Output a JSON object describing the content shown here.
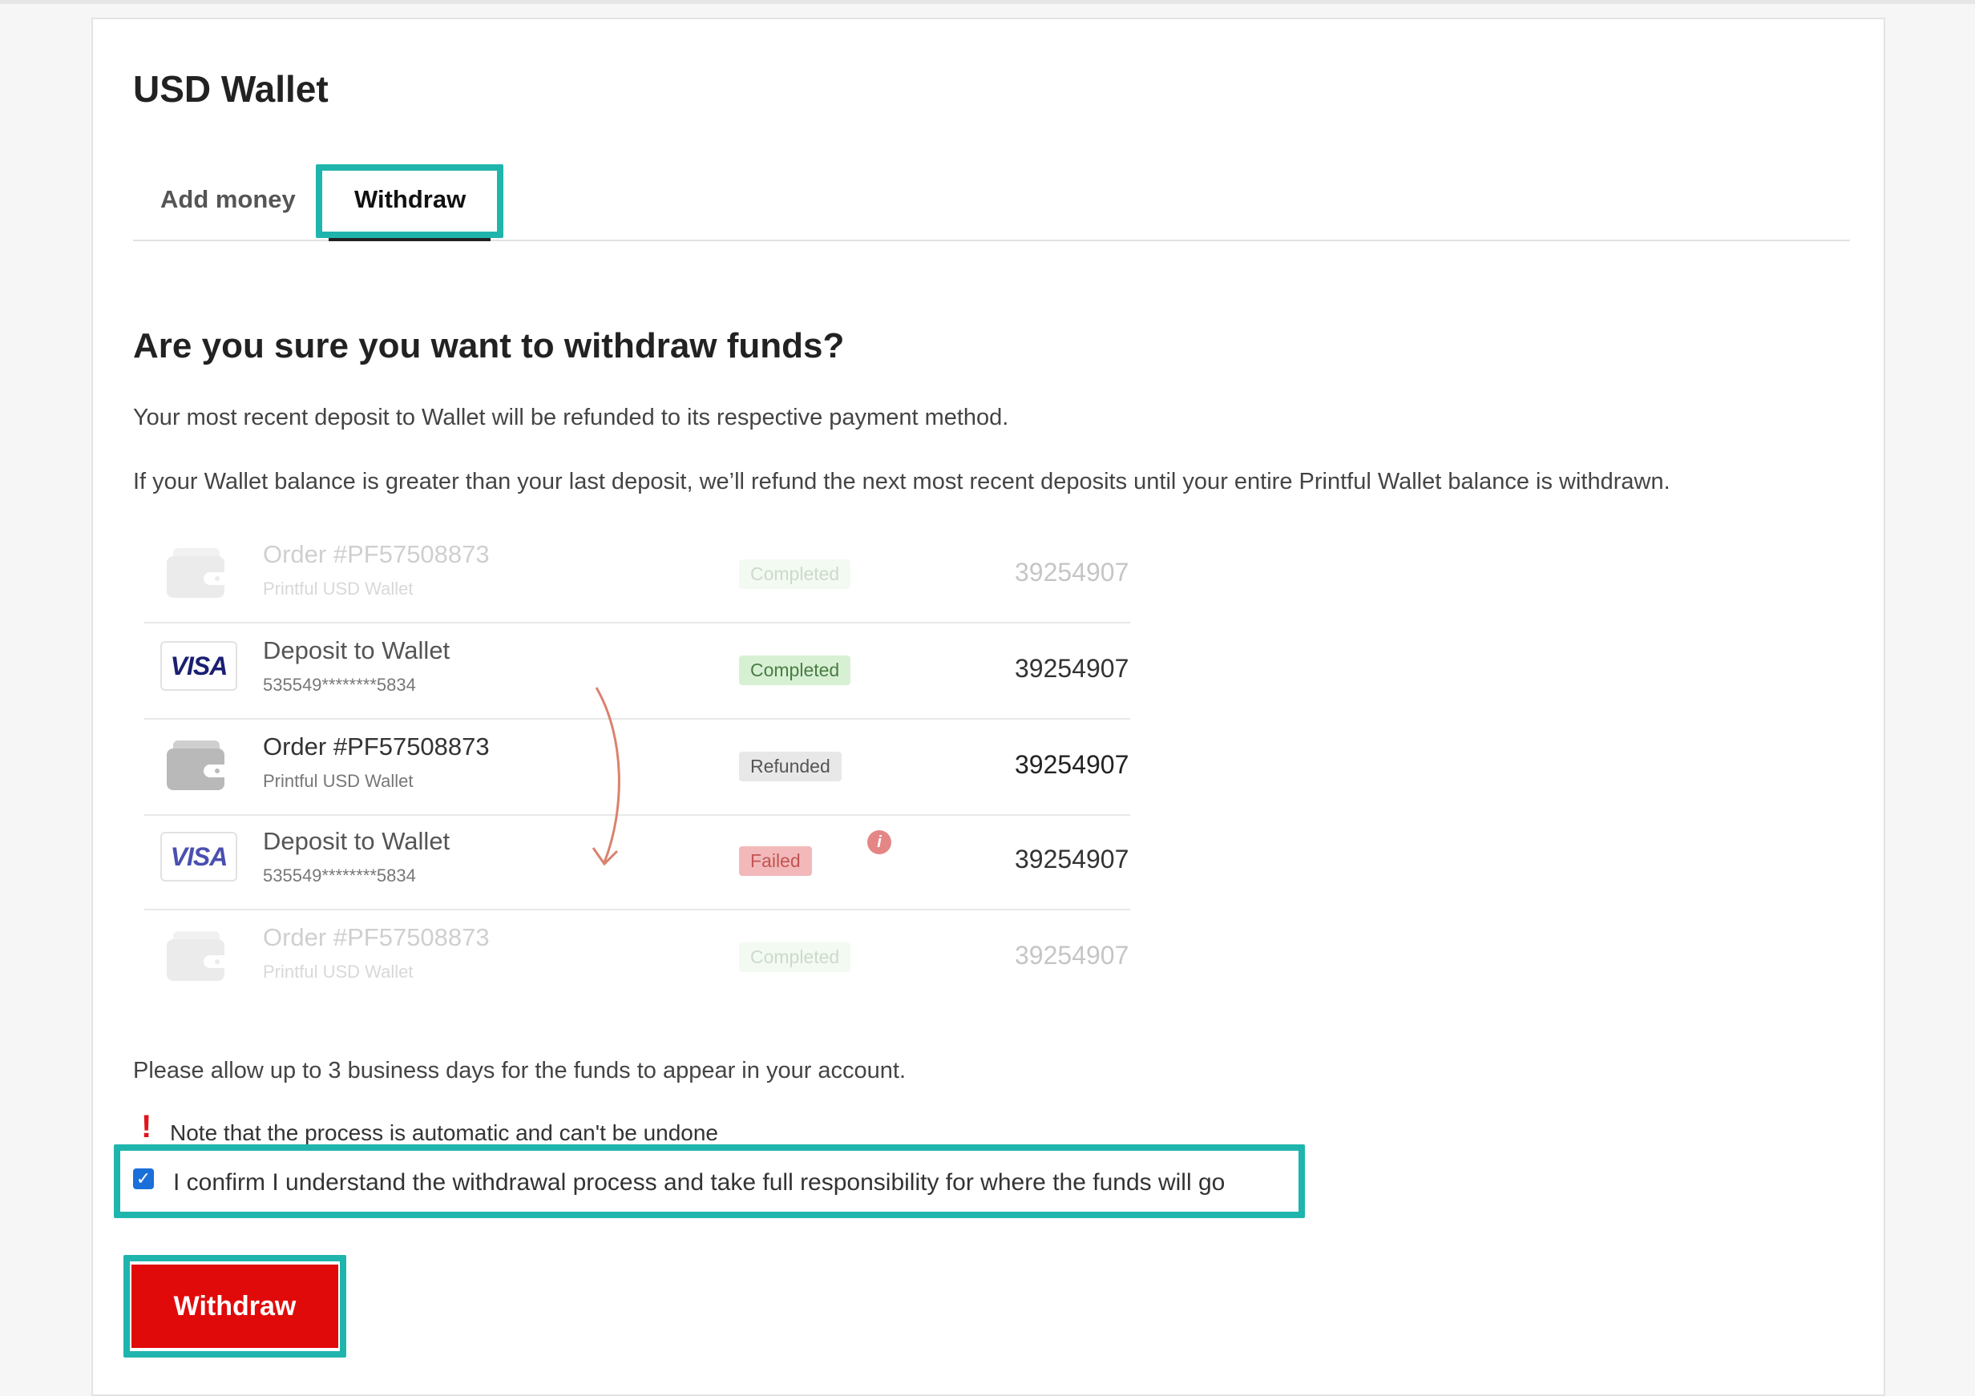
{
  "wallet_title": "USD Wallet",
  "tabs": [
    {
      "label": "Add money",
      "active": false
    },
    {
      "label": "Withdraw",
      "active": true
    }
  ],
  "heading": "Are you sure you want to withdraw funds?",
  "paragraphs": [
    "Your most recent deposit to Wallet will be refunded to its respective payment method.",
    "If your Wallet balance is greater than your last deposit, we’ll refund the next most recent deposits until your entire Printful Wallet balance is withdrawn."
  ],
  "transactions": [
    {
      "icon": "wallet-icon",
      "name": "Order #PF57508873",
      "sub": "Printful USD Wallet",
      "status": "Completed",
      "amount": "39254907",
      "faded": true
    },
    {
      "icon": "visa-icon",
      "name": "Deposit to Wallet",
      "sub": "535549********5834",
      "status": "Completed",
      "amount": "39254907",
      "faded": false
    },
    {
      "icon": "wallet-icon",
      "name": "Order #PF57508873",
      "sub": "Printful USD Wallet",
      "status": "Refunded",
      "amount": "39254907",
      "faded": false
    },
    {
      "icon": "visa-icon",
      "name": "Deposit to Wallet",
      "sub": "535549********5834",
      "status": "Failed",
      "amount": "39254907",
      "faded": false
    },
    {
      "icon": "wallet-icon",
      "name": "Order #PF57508873",
      "sub": "Printful USD Wallet",
      "status": "Completed",
      "amount": "39254907",
      "faded": true
    }
  ],
  "visa_text": "VISA",
  "info_symbol": "i",
  "processing_note": "Please allow up to 3 business days for the funds to appear in your account.",
  "warning": {
    "symbol": "!",
    "text": "Note that the process is automatic and can't be undone"
  },
  "confirm": {
    "checked": true,
    "check_glyph": "✓",
    "label": "I confirm I understand the withdrawal process and take full responsibility for where the funds will go"
  },
  "withdraw_button": "Withdraw",
  "colors": {
    "highlight": "#1fb5ad",
    "danger": "#e10a0a",
    "checkbox": "#1a6fd8"
  }
}
